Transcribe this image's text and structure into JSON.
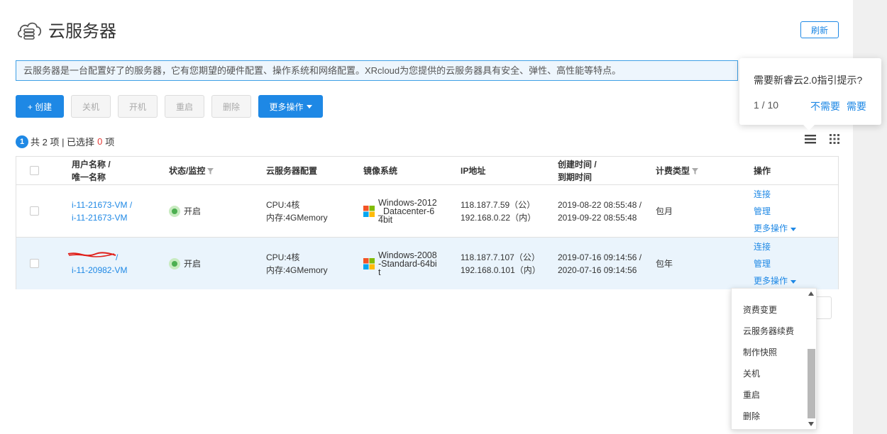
{
  "page": {
    "title": "云服务器",
    "refresh_label": "刷新",
    "description": "云服务器是一台配置好了的服务器，它有您期望的硬件配置、操作系统和网络配置。XRcloud为您提供的云服务器具有安全、弹性、高性能等特点。"
  },
  "toolbar": {
    "create_label": "+ 创建",
    "shutdown_label": "关机",
    "start_label": "开机",
    "restart_label": "重启",
    "delete_label": "删除",
    "more_label": "更多操作"
  },
  "summary": {
    "badge": "1",
    "total_text": "共 2 项 | 已选择",
    "selected_count": "0",
    "unit": "项"
  },
  "table": {
    "columns": {
      "name_line1": "用户名称 /",
      "name_line2": "唯一名称",
      "status": "状态/监控",
      "config": "云服务器配置",
      "image": "镜像系统",
      "ip": "IP地址",
      "time_line1": "创建时间 /",
      "time_line2": "到期时间",
      "billing": "计费类型",
      "ops": "操作"
    },
    "rows": [
      {
        "user_name": "i-11-21673-VM /",
        "unique_name": "i-11-21673-VM",
        "status": "开启",
        "cpu": "CPU:4核",
        "memory": "内存:4GMemory",
        "os": "Windows-2012_Datacenter-64bit",
        "ip_public": "118.187.7.59（公）",
        "ip_private": "192.168.0.22（内）",
        "created": "2019-08-22 08:55:48 /",
        "expires": "2019-09-22 08:55:48",
        "billing": "包月",
        "op_connect": "连接",
        "op_manage": "管理",
        "op_more": "更多操作"
      },
      {
        "user_name": "/",
        "unique_name": "i-11-20982-VM",
        "status": "开启",
        "cpu": "CPU:4核",
        "memory": "内存:4GMemory",
        "os": "Windows-2008-Standard-64bit",
        "ip_public": "118.187.7.107（公）",
        "ip_private": "192.168.0.101（内）",
        "created": "2019-07-16 09:14:56 /",
        "expires": "2020-07-16 09:14:56",
        "billing": "包年",
        "op_connect": "连接",
        "op_manage": "管理",
        "op_more": "更多操作"
      }
    ]
  },
  "dropdown": {
    "items": [
      "资费变更",
      "云服务器续费",
      "制作快照",
      "关机",
      "重启",
      "删除"
    ]
  },
  "tour": {
    "question": "需要新睿云2.0指引提示?",
    "counter": "1 / 10",
    "decline": "不需要",
    "accept": "需要"
  },
  "colors": {
    "accent": "#1e88e5",
    "status_on": "#4caf50",
    "selected_count": "#e53935",
    "row_highlight": "#eaf4fc"
  }
}
